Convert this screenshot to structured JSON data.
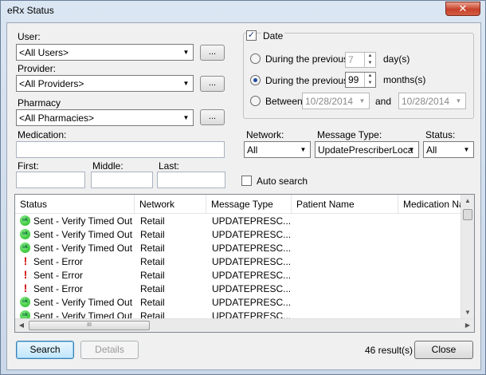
{
  "window": {
    "title": "eRx Status",
    "close_glyph": "✕"
  },
  "filters": {
    "user_label": "User:",
    "user_value": "<All Users>",
    "provider_label": "Provider:",
    "provider_value": "<All Providers>",
    "pharmacy_label": "Pharmacy",
    "pharmacy_value": "<All Pharmacies>",
    "ellipsis": "...",
    "medication_label": "Medication:",
    "first_label": "First:",
    "middle_label": "Middle:",
    "last_label": "Last:"
  },
  "date": {
    "checkbox_label": "Date",
    "checked": true,
    "during1_label": "During the previous",
    "during1_value": "7",
    "during1_unit": "day(s)",
    "during2_label": "During the previous",
    "during2_value": "99",
    "during2_unit": "months(s)",
    "between_label": "Between",
    "from_value": "10/28/2014",
    "and_label": "and",
    "to_value": "10/28/2014",
    "selected": "during2"
  },
  "criteria": {
    "network_label": "Network:",
    "network_value": "All",
    "message_type_label": "Message Type:",
    "message_type_value": "UpdatePrescriberLoca",
    "status_label": "Status:",
    "status_value": "All",
    "auto_search_label": "Auto search"
  },
  "list": {
    "columns": [
      "Status",
      "Network",
      "Message Type",
      "Patient Name",
      "Medication Nar"
    ],
    "rows": [
      {
        "icon": "ok",
        "status": "Sent - Verify Timed Out",
        "network": "Retail",
        "message_type": "UPDATEPRESC..."
      },
      {
        "icon": "ok",
        "status": "Sent - Verify Timed Out",
        "network": "Retail",
        "message_type": "UPDATEPRESC..."
      },
      {
        "icon": "ok",
        "status": "Sent - Verify Timed Out",
        "network": "Retail",
        "message_type": "UPDATEPRESC..."
      },
      {
        "icon": "error",
        "status": "Sent - Error",
        "network": "Retail",
        "message_type": "UPDATEPRESC..."
      },
      {
        "icon": "error",
        "status": "Sent - Error",
        "network": "Retail",
        "message_type": "UPDATEPRESC..."
      },
      {
        "icon": "error",
        "status": "Sent - Error",
        "network": "Retail",
        "message_type": "UPDATEPRESC..."
      },
      {
        "icon": "ok",
        "status": "Sent - Verify Timed Out",
        "network": "Retail",
        "message_type": "UPDATEPRESC..."
      },
      {
        "icon": "ok",
        "status": "Sent - Verify Timed Out",
        "network": "Retail",
        "message_type": "UPDATEPRESC..."
      }
    ],
    "ok_icon_text": "ok",
    "error_icon_text": "!",
    "hscroll_grip": "III"
  },
  "footer": {
    "search_label": "Search",
    "details_label": "Details",
    "result_count": "46 result(s)",
    "close_label": "Close"
  },
  "colors": {
    "accent": "#3c7fb1",
    "ok": "#18b418",
    "error": "#d01010"
  }
}
